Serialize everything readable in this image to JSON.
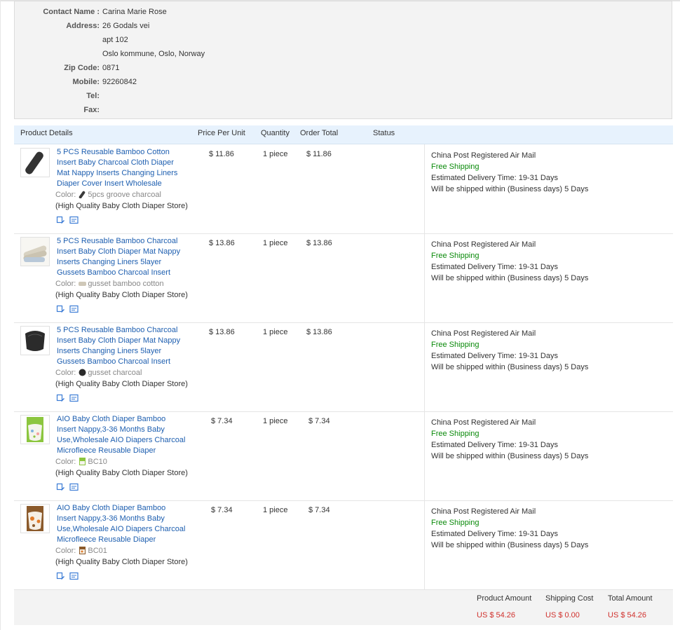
{
  "contact": {
    "name_label": "Contact Name :",
    "name": "Carina Marie Rose",
    "address_label": "Address:",
    "address_line1": "26 Godals vei",
    "address_line2": "apt 102",
    "address_line3": "Oslo kommune, Oslo, Norway",
    "zip_label": "Zip Code:",
    "zip": "0871",
    "mobile_label": "Mobile:",
    "mobile": "92260842",
    "tel_label": "Tel:",
    "tel": "",
    "fax_label": "Fax:",
    "fax": ""
  },
  "table": {
    "headers": {
      "product": "Product Details",
      "price": "Price Per Unit",
      "quantity": "Quantity",
      "total": "Order Total",
      "status": "Status"
    },
    "rows": [
      {
        "title": "5 PCS Reusable Bamboo Cotton Insert Baby Charcoal Cloth Diaper Mat Nappy Inserts Changing Liners Diaper Cover Insert Wholesale",
        "color_label": "Color:",
        "color_value": "5pcs groove charcoal",
        "store": "(High Quality Baby Cloth Diaper Store)",
        "price": "$ 11.86",
        "quantity": "1 piece",
        "total": "$ 11.86",
        "shipping_method": "China Post Registered Air Mail",
        "shipping_cost": "Free Shipping",
        "delivery": "Estimated Delivery Time:  19-31 Days",
        "ships_within": "Will be shipped within (Business days) 5 Days",
        "swatch_color": "#3a3a3a"
      },
      {
        "title": "5 PCS Reusable Bamboo Charcoal Insert Baby Cloth Diaper Mat Nappy Inserts Changing Liners 5layer Gussets Bamboo Charcoal Insert",
        "color_label": "Color:",
        "color_value": "gusset bamboo cotton",
        "store": "(High Quality Baby Cloth Diaper Store)",
        "price": "$ 13.86",
        "quantity": "1 piece",
        "total": "$ 13.86",
        "shipping_method": "China Post Registered Air Mail",
        "shipping_cost": "Free Shipping",
        "delivery": "Estimated Delivery Time:  19-31 Days",
        "ships_within": "Will be shipped within (Business days) 5 Days",
        "swatch_color": "#cfc8b8"
      },
      {
        "title": "5 PCS Reusable Bamboo Charcoal Insert Baby Cloth Diaper Mat Nappy Inserts Changing Liners 5layer Gussets Bamboo Charcoal Insert",
        "color_label": "Color:",
        "color_value": "gusset charcoal",
        "store": "(High Quality Baby Cloth Diaper Store)",
        "price": "$ 13.86",
        "quantity": "1 piece",
        "total": "$ 13.86",
        "shipping_method": "China Post Registered Air Mail",
        "shipping_cost": "Free Shipping",
        "delivery": "Estimated Delivery Time:  19-31 Days",
        "ships_within": "Will be shipped within (Business days) 5 Days",
        "swatch_color": "#2b2b2b"
      },
      {
        "title": "AIO Baby Cloth Diaper Bamboo Insert Nappy,3-36 Months Baby Use,Wholesale AIO Diapers Charcoal Microfleece Reusable Diaper",
        "color_label": "Color:",
        "color_value": "BC10",
        "store": "(High Quality Baby Cloth Diaper Store)",
        "price": "$ 7.34",
        "quantity": "1 piece",
        "total": "$ 7.34",
        "shipping_method": "China Post Registered Air Mail",
        "shipping_cost": "Free Shipping",
        "delivery": "Estimated Delivery Time:  19-31 Days",
        "ships_within": "Will be shipped within (Business days) 5 Days",
        "swatch_color": "#8cc63f"
      },
      {
        "title": "AIO Baby Cloth Diaper Bamboo Insert Nappy,3-36 Months Baby Use,Wholesale AIO Diapers Charcoal Microfleece Reusable Diaper",
        "color_label": "Color:",
        "color_value": "BC01",
        "store": "(High Quality Baby Cloth Diaper Store)",
        "price": "$ 7.34",
        "quantity": "1 piece",
        "total": "$ 7.34",
        "shipping_method": "China Post Registered Air Mail",
        "shipping_cost": "Free Shipping",
        "delivery": "Estimated Delivery Time:  19-31 Days",
        "ships_within": "Will be shipped within (Business days) 5 Days",
        "swatch_color": "#8b5a2b"
      }
    ]
  },
  "summary": {
    "product_amount_label": "Product Amount",
    "product_amount": "US $ 54.26",
    "shipping_cost_label": "Shipping Cost",
    "shipping_cost": "US $ 0.00",
    "total_amount_label": "Total Amount",
    "total_amount": "US $ 54.26"
  },
  "icons": {
    "snapshot": "snapshot-icon",
    "compare": "compare-icon"
  },
  "colors": {
    "link": "#1e5fb0",
    "free_shipping": "#0a8a0a",
    "amount": "#d0312d",
    "header_bg": "#e7f2fd"
  }
}
